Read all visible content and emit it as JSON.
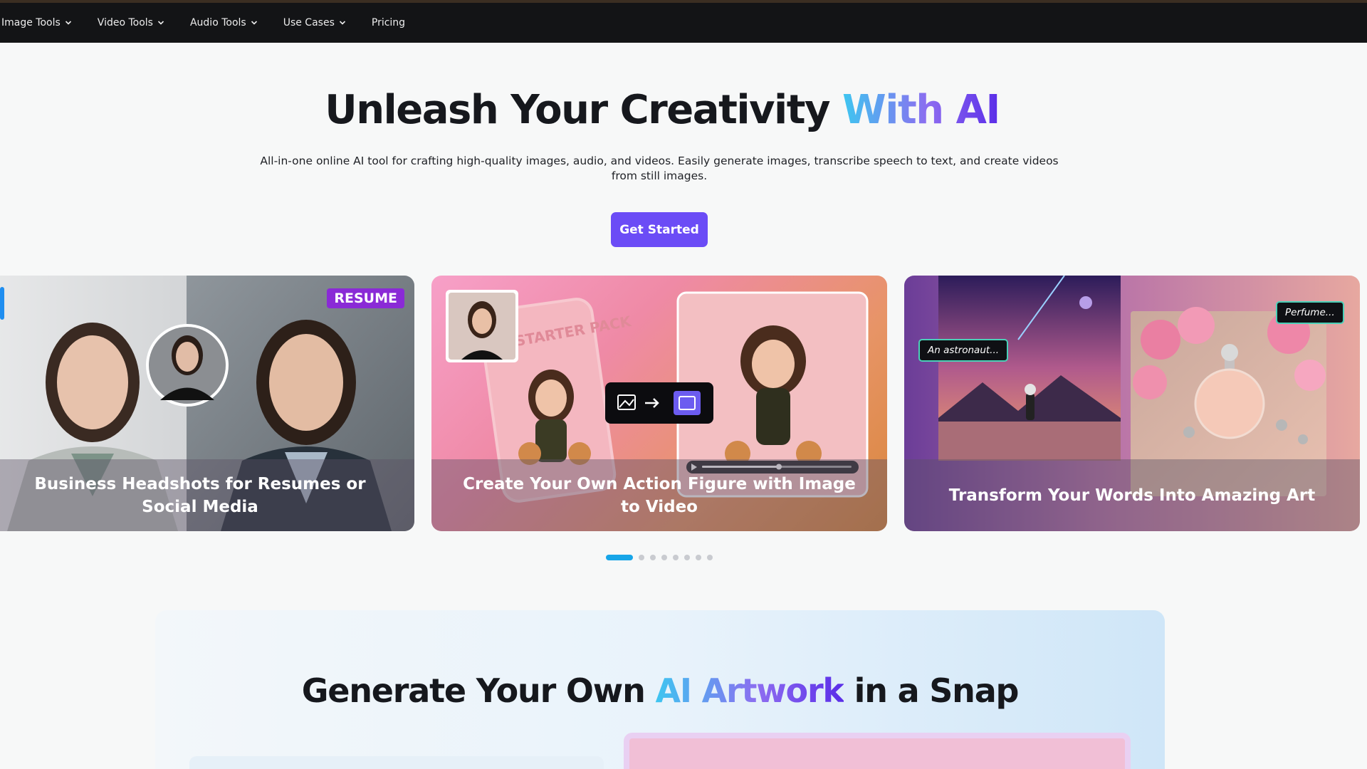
{
  "nav": {
    "items": [
      {
        "label": "Image Tools",
        "has_dropdown": true
      },
      {
        "label": "Video Tools",
        "has_dropdown": true
      },
      {
        "label": "Audio Tools",
        "has_dropdown": true
      },
      {
        "label": "Use Cases",
        "has_dropdown": true
      },
      {
        "label": "Pricing",
        "has_dropdown": false
      }
    ]
  },
  "hero": {
    "title_main": "Unleash Your Creativity ",
    "title_accent": "With AI",
    "subtitle": "All-in-one online AI tool for crafting high-quality images, audio, and videos. Easily generate images, transcribe speech to text, and create videos from still images.",
    "cta_label": "Get Started"
  },
  "carousel": {
    "cards": [
      {
        "caption": "Business Headshots for Resumes or Social Media",
        "badge": "RESUME"
      },
      {
        "caption": "Create Your Own Action Figure with Image to Video",
        "pack_text": "STARTER PACK"
      },
      {
        "caption": "Transform Your Words Into Amazing Art",
        "tag1": "An astronaut...",
        "tag2": "Perfume..."
      }
    ],
    "dot_count": 8,
    "active_index": 0
  },
  "section2": {
    "title_pre": "Generate Your Own ",
    "title_accent": "AI Artwork",
    "title_post": " in a Snap"
  },
  "colors": {
    "nav_bg": "#131416",
    "cta_bg": "#6b4cf6",
    "dot_active": "#17a5e8",
    "badge_resume": "#8a2ad6"
  }
}
